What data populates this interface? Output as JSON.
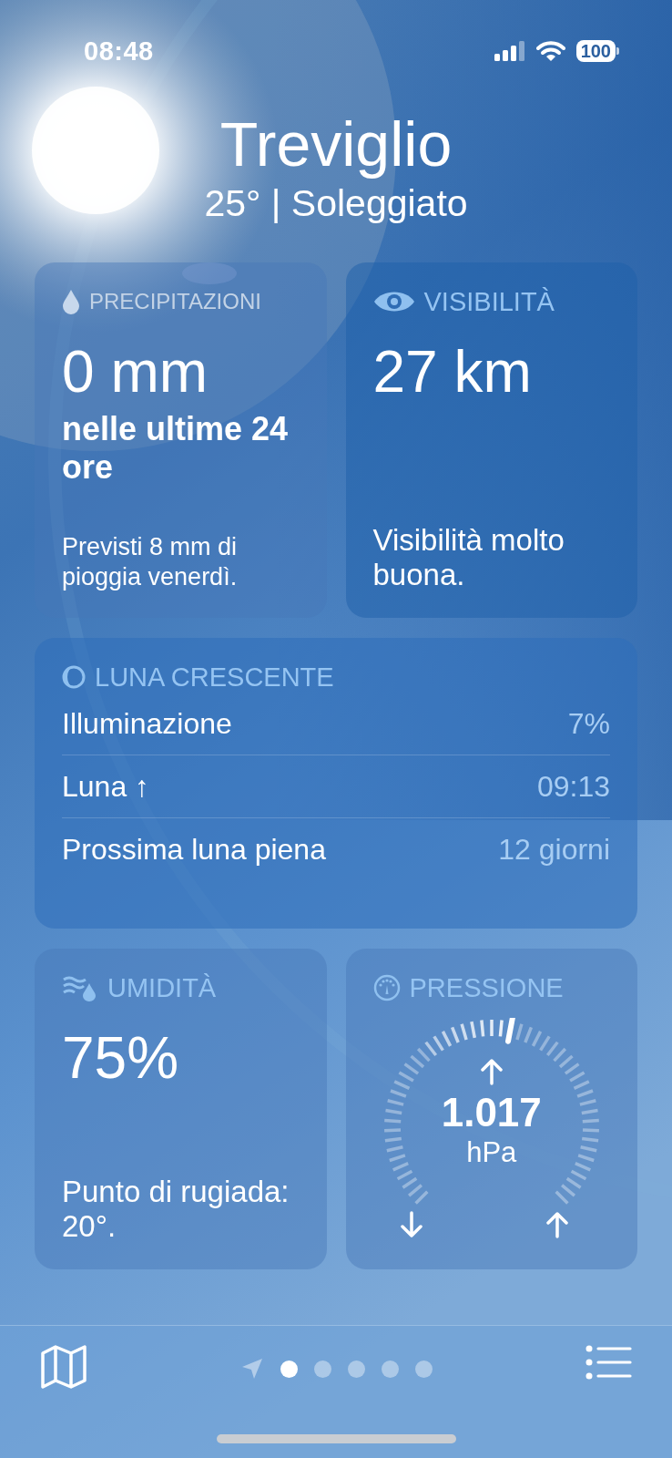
{
  "status_bar": {
    "time": "08:48",
    "battery": "100"
  },
  "header": {
    "city": "Treviglio",
    "summary": "25° | Soleggiato"
  },
  "precipitation": {
    "title": "PRECIPITAZIONI",
    "value": "0 mm",
    "period": "nelle ultime 24 ore",
    "note": "Previsti 8 mm di pioggia venerdì."
  },
  "visibility": {
    "title": "VISIBILITÀ",
    "value": "27 km",
    "note": "Visibilità molto buona."
  },
  "moon": {
    "title": "LUNA CRESCENTE",
    "rows": [
      {
        "label": "Illuminazione",
        "value": "7%"
      },
      {
        "label": "Luna ↑",
        "value": "09:13"
      },
      {
        "label": "Prossima luna piena",
        "value": "12 giorni"
      }
    ]
  },
  "humidity": {
    "title": "UMIDITÀ",
    "value": "75%",
    "note": "Punto di rugiada: 20°."
  },
  "pressure": {
    "title": "PRESSIONE",
    "value": "1.017",
    "unit": "hPa"
  },
  "pages": [
    {
      "kind": "location",
      "selected": false
    },
    {
      "kind": "dot",
      "selected": true
    },
    {
      "kind": "dot",
      "selected": false
    },
    {
      "kind": "dot",
      "selected": false
    },
    {
      "kind": "dot",
      "selected": false
    },
    {
      "kind": "dot",
      "selected": false
    }
  ]
}
